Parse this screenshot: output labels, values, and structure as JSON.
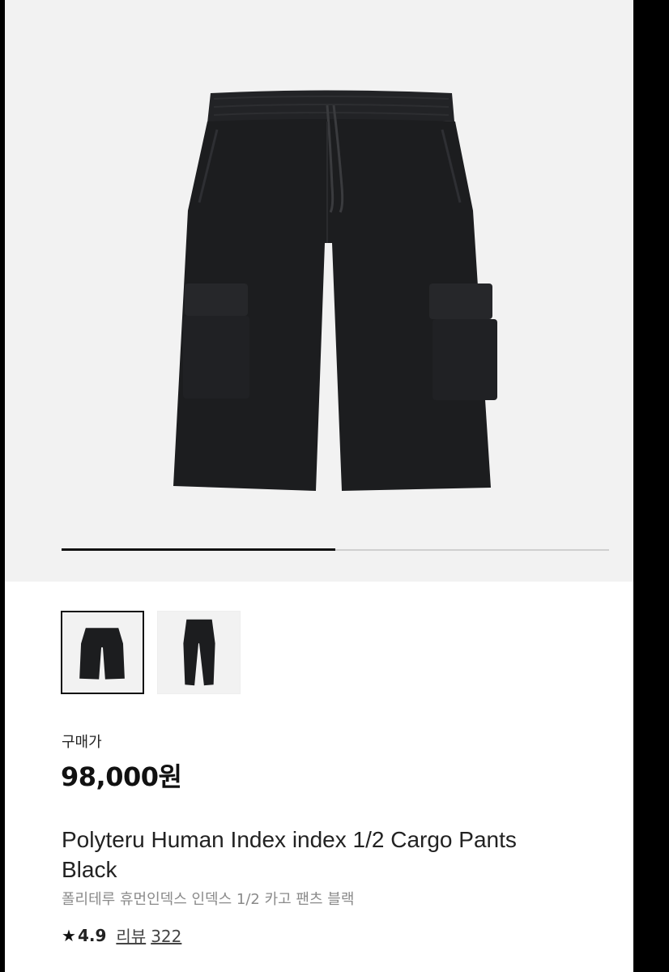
{
  "product": {
    "price_label": "구매가",
    "price": "98,000원",
    "title_en": "Polyteru Human Index index 1/2 Cargo Pants Black",
    "title_ko": "폴리테루 휴먼인덱스 인덱스 1/2 카고 팬츠 블랙"
  },
  "gallery": {
    "progress_fraction": 0.5,
    "thumbnails": [
      {
        "name": "cargo-shorts-thumbnail",
        "active": true
      },
      {
        "name": "long-pants-thumbnail",
        "active": false
      }
    ]
  },
  "rating": {
    "icon": "star-icon",
    "value": "4.9",
    "review_label": "리뷰",
    "review_count": "322"
  },
  "colors": {
    "garment": "#1c1d1f",
    "hero_bg": "#f2f2f2",
    "accent": "#111111"
  }
}
